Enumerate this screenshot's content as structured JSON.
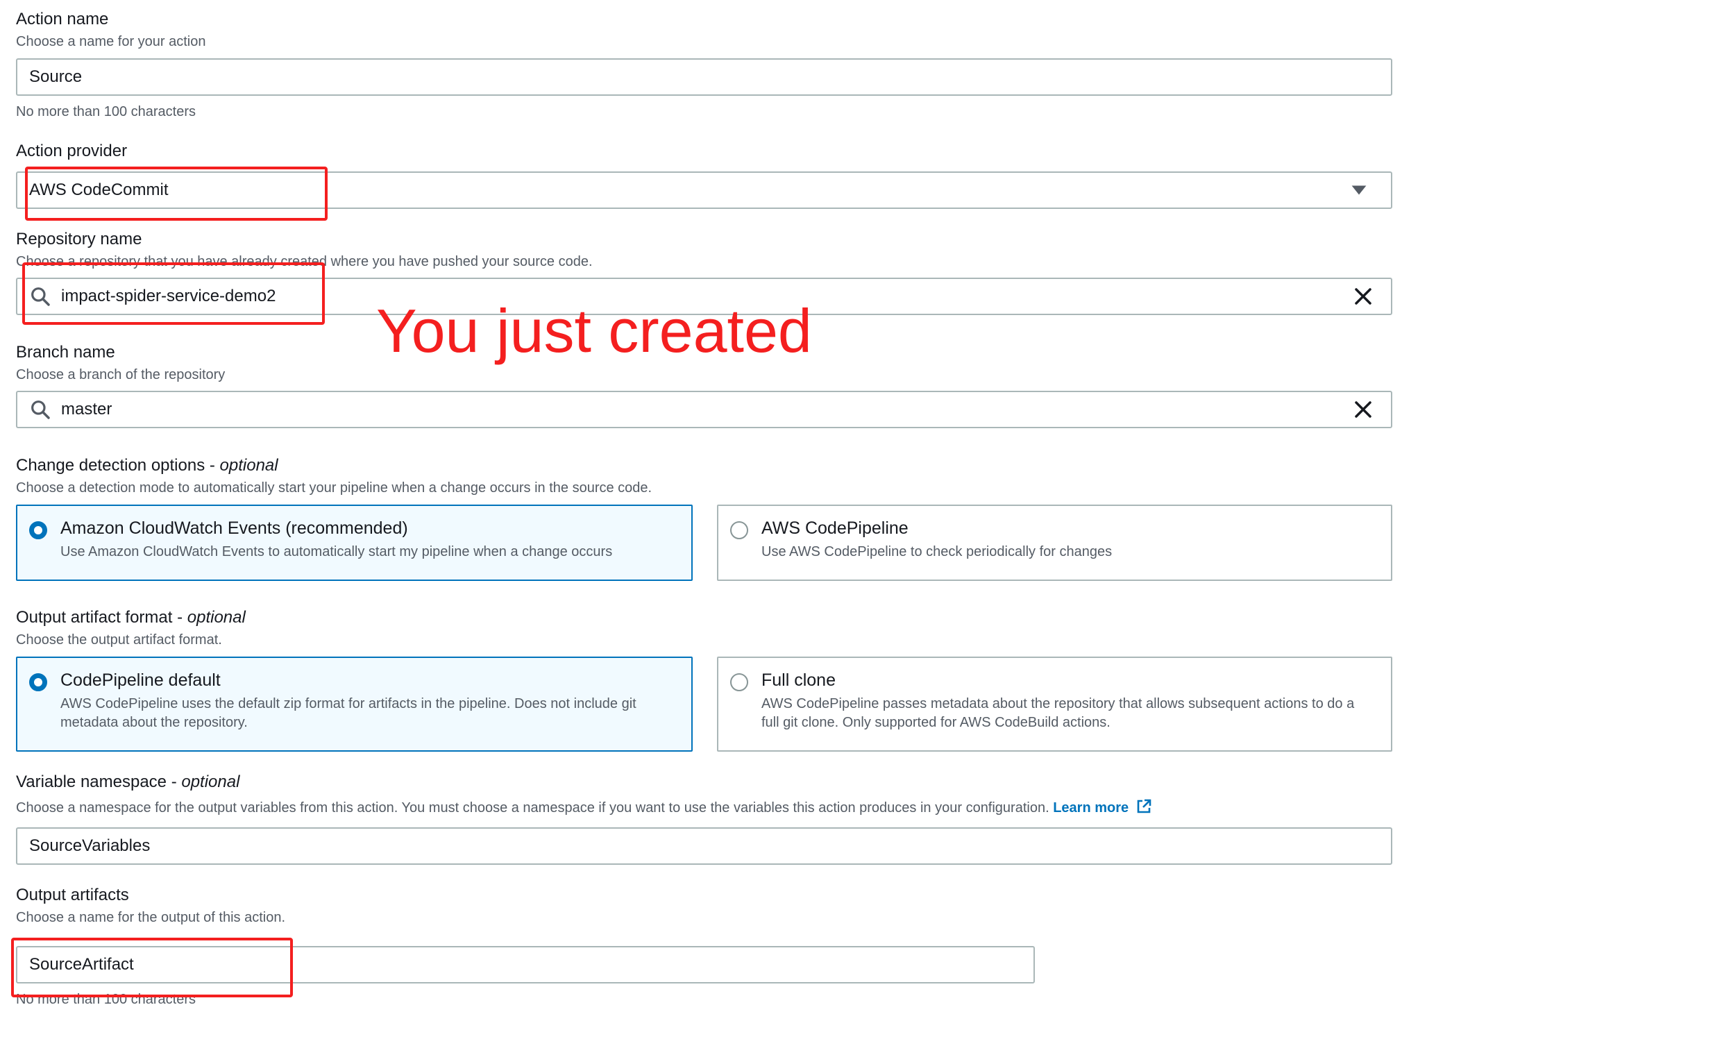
{
  "action_name": {
    "label": "Action name",
    "description": "Choose a name for your action",
    "value": "Source",
    "constraint": "No more than 100 characters"
  },
  "action_provider": {
    "label": "Action provider",
    "value": "AWS CodeCommit"
  },
  "repository_name": {
    "label": "Repository name",
    "description": "Choose a repository that you have already created where you have pushed your source code.",
    "value": "impact-spider-service-demo2"
  },
  "annotation": {
    "text": "You just created",
    "color": "#f41f1f"
  },
  "branch_name": {
    "label": "Branch name",
    "description": "Choose a branch of the repository",
    "value": "master"
  },
  "change_detection": {
    "label": "Change detection options",
    "optional": "optional",
    "description": "Choose a detection mode to automatically start your pipeline when a change occurs in the source code.",
    "options": [
      {
        "title": "Amazon CloudWatch Events (recommended)",
        "description": "Use Amazon CloudWatch Events to automatically start my pipeline when a change occurs",
        "selected": true
      },
      {
        "title": "AWS CodePipeline",
        "description": "Use AWS CodePipeline to check periodically for changes",
        "selected": false
      }
    ]
  },
  "output_artifact_format": {
    "label": "Output artifact format",
    "optional": "optional",
    "description": "Choose the output artifact format.",
    "options": [
      {
        "title": "CodePipeline default",
        "description": "AWS CodePipeline uses the default zip format for artifacts in the pipeline. Does not include git metadata about the repository.",
        "selected": true
      },
      {
        "title": "Full clone",
        "description": "AWS CodePipeline passes metadata about the repository that allows subsequent actions to do a full git clone. Only supported for AWS CodeBuild actions.",
        "selected": false
      }
    ]
  },
  "variable_namespace": {
    "label": "Variable namespace",
    "optional": "optional",
    "description": "Choose a namespace for the output variables from this action. You must choose a namespace if you want to use the variables this action produces in your configuration.",
    "learn_more": "Learn more",
    "value": "SourceVariables"
  },
  "output_artifacts": {
    "label": "Output artifacts",
    "description": "Choose a name for the output of this action.",
    "value": "SourceArtifact",
    "constraint": "No more than 100 characters"
  },
  "colors": {
    "accent": "#0073bb",
    "border": "#aab7b8",
    "annotation": "#f41f1f",
    "selected_bg": "#f1faff"
  },
  "icons": [
    "search-icon",
    "clear-icon",
    "dropdown-caret-icon",
    "external-link-icon"
  ]
}
